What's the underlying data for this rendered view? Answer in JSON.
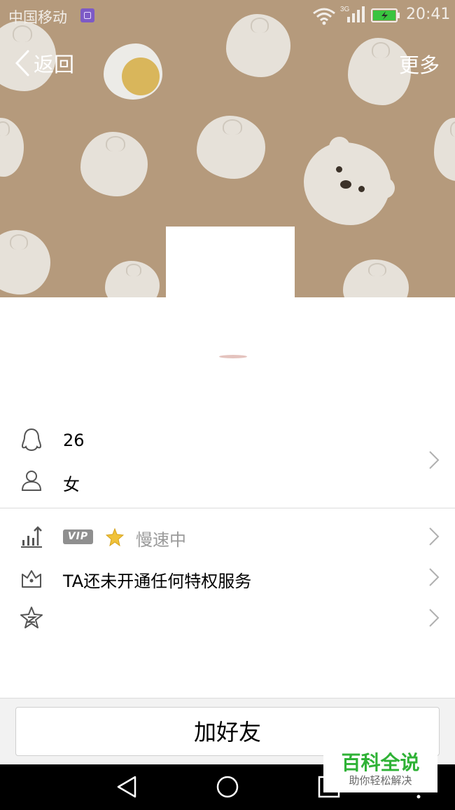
{
  "status_bar": {
    "carrier": "中国移动",
    "network": "3G",
    "time": "20:41"
  },
  "header": {
    "back_label": "返回",
    "more_label": "更多"
  },
  "profile": {
    "qq_number": "26",
    "gender": "女"
  },
  "privileges": {
    "vip_badge": "VIP",
    "vip_status": "慢速中",
    "service_text": "TA还未开通任何特权服务",
    "zone_text": ""
  },
  "actions": {
    "add_friend": "加好友"
  },
  "watermark": {
    "title": "百科全说",
    "subtitle": "助你轻松解决"
  },
  "colors": {
    "cover": "#b59a7c",
    "watermark_green": "#2fb236",
    "vip_gray": "#8f8f8f"
  }
}
